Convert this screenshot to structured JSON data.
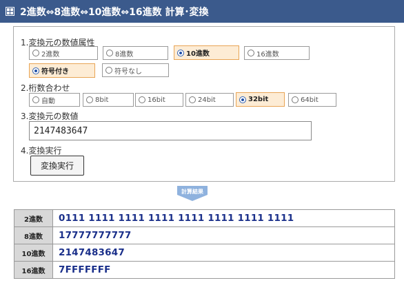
{
  "header": {
    "title": "2進数⇔8進数⇔10進数⇔16進数 計算･変換",
    "icon": "grid-icon"
  },
  "section1": {
    "label": "1.変換元の数値属性",
    "bases": [
      {
        "label": "2進数",
        "selected": false
      },
      {
        "label": "8進数",
        "selected": false
      },
      {
        "label": "10進数",
        "selected": true
      },
      {
        "label": "16進数",
        "selected": false
      }
    ],
    "signs": [
      {
        "label": "符号付き",
        "selected": true
      },
      {
        "label": "符号なし",
        "selected": false
      }
    ]
  },
  "section2": {
    "label": "2.桁数合わせ",
    "digits": [
      {
        "label": "自動",
        "selected": false
      },
      {
        "label": "8bit",
        "selected": false
      },
      {
        "label": "16bit",
        "selected": false
      },
      {
        "label": "24bit",
        "selected": false
      },
      {
        "label": "32bit",
        "selected": true
      },
      {
        "label": "64bit",
        "selected": false
      }
    ]
  },
  "section3": {
    "label": "3.変換元の数値",
    "value": "2147483647"
  },
  "section4": {
    "label": "4.変換実行",
    "button": "変換実行"
  },
  "result_badge": "計算結果",
  "results": [
    {
      "label": "2進数",
      "value": "0111 1111 1111 1111 1111 1111 1111 1111"
    },
    {
      "label": "8進数",
      "value": "17777777777"
    },
    {
      "label": "10進数",
      "value": "2147483647"
    },
    {
      "label": "16進数",
      "value": "7FFFFFFF"
    }
  ],
  "colors": {
    "header_bg": "#3b5a8c",
    "selected_bg": "#fdecd5",
    "selected_border": "#e8a454",
    "result_text": "#1a2f8a",
    "badge": "#8fb2de"
  }
}
